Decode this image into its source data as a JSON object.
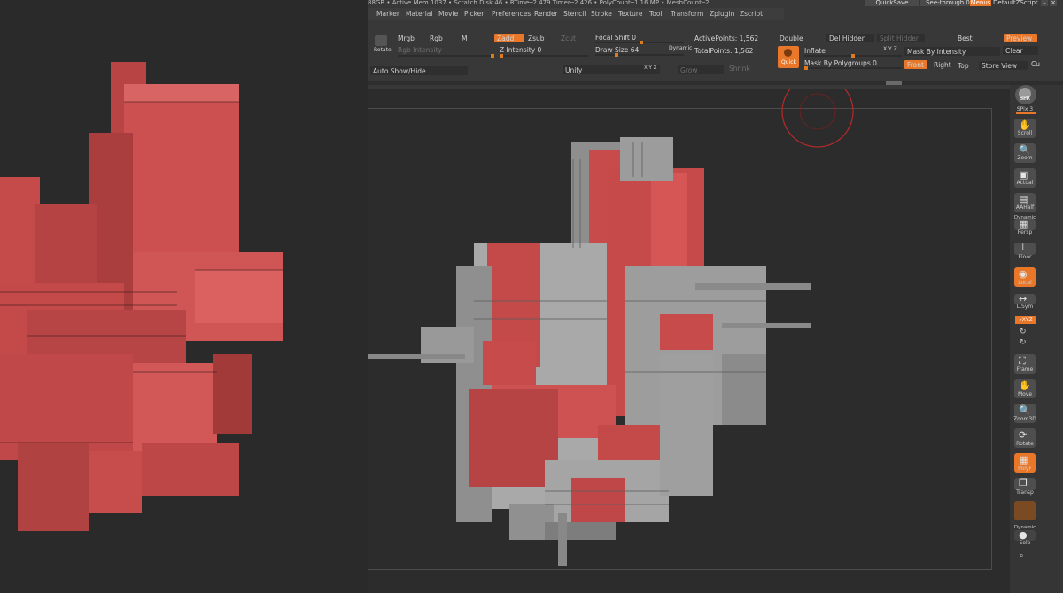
{
  "status_bar": {
    "text": "88GB • Active Mem 1037 • Scratch Disk 46 • RTime─2.479 Timer─2.426 • PolyCount─1.16 MP • MeshCount─2"
  },
  "top_right": {
    "quicksave": "QuickSave",
    "seethrough": "See-through  0",
    "menus": "Menus",
    "script": "DefaultZScript"
  },
  "menubar": [
    "Marker",
    "Material",
    "Movie",
    "Picker",
    "Preferences",
    "Render",
    "Stencil",
    "Stroke",
    "Texture",
    "Tool",
    "Transform",
    "Zplugin",
    "Zscript"
  ],
  "toolbar": {
    "rotate": "Rotate",
    "mrgb": "Mrgb",
    "rgb": "Rgb",
    "m": "M",
    "zadd": "Zadd",
    "zsub": "Zsub",
    "zcut": "Zcut",
    "rgb_intensity": "Rgb Intensity",
    "z_intensity": "Z Intensity 0",
    "focal_shift": "Focal Shift 0",
    "draw_size": "Draw Size 64",
    "dynamic": "Dynamic",
    "active_points": "ActivePoints: 1,562",
    "total_points": "TotalPoints: 1,562",
    "double": "Double",
    "del_hidden": "Del Hidden",
    "split_hidden": "Split Hidden",
    "best": "Best",
    "preview": "Preview",
    "quick": "Quick",
    "inflate": "Inflate",
    "xyz": "X Y Z",
    "mask_by_intensity": "Mask By Intensity",
    "clear": "Clear",
    "mask_by_polygroups": "Mask By Polygroups 0",
    "front": "Front",
    "right": "Right",
    "top": "Top",
    "store_view": "Store View",
    "cu": "Cu",
    "auto_show_hide": "Auto Show/Hide",
    "unify": "Unify",
    "grow": "Grow",
    "shrink": "Shrink"
  },
  "shelf": {
    "bpr": "BPR",
    "spix": "SPix 3",
    "scroll": "Scroll",
    "zoom": "Zoom",
    "actual": "Actual",
    "aahalf": "AAHalf",
    "dynamic": "Dynamic",
    "persp": "Persp",
    "floor": "Floor",
    "local": "Local",
    "lsym": "L.Sym",
    "xyz": "»XYZ",
    "frame": "Frame",
    "move": "Move",
    "zoom3d": "Zoom3D",
    "rotate": "Rotate",
    "polyf": "PolyF",
    "transp": "Transp",
    "dynamic2": "Dynamic",
    "solo": "Solo"
  },
  "colors": {
    "accent": "#e8772a",
    "model_red": "#c84b4b",
    "model_gray": "#9a9a9a"
  }
}
